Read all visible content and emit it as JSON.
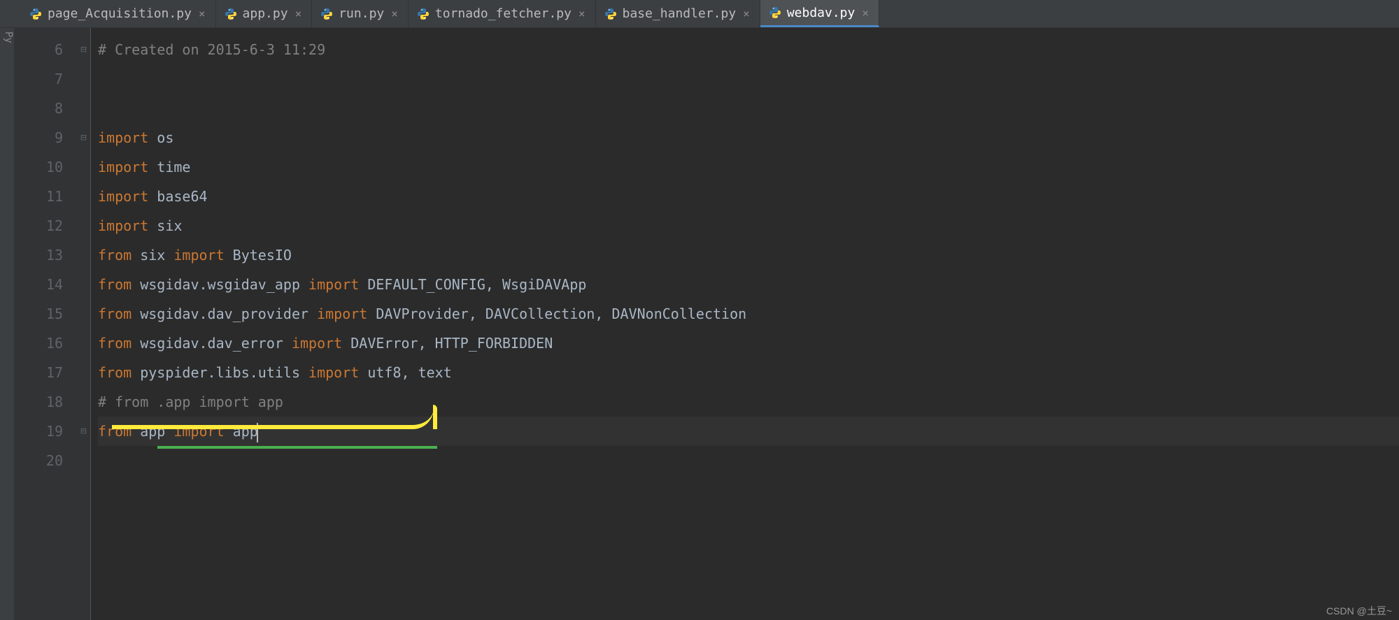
{
  "tabs": [
    {
      "label": "page_Acquisition.py",
      "active": false
    },
    {
      "label": "app.py",
      "active": false
    },
    {
      "label": "run.py",
      "active": false
    },
    {
      "label": "tornado_fetcher.py",
      "active": false
    },
    {
      "label": "base_handler.py",
      "active": false
    },
    {
      "label": "webdav.py",
      "active": true
    }
  ],
  "gutter_start": 6,
  "gutter_end": 20,
  "lines": {
    "l6": "# Created on 2015-6-3 11:29",
    "l9_kw": "import",
    "l9_txt": " os",
    "l10_kw": "import",
    "l10_txt": " time",
    "l11_kw": "import",
    "l11_txt": " base64",
    "l12_kw": "import",
    "l12_txt": " six",
    "l13_kw1": "from",
    "l13_txt1": " six ",
    "l13_kw2": "import",
    "l13_txt2": " BytesIO",
    "l14_kw1": "from",
    "l14_txt1": " wsgidav.wsgidav_app ",
    "l14_kw2": "import",
    "l14_txt2": " DEFAULT_CONFIG, WsgiDAVApp",
    "l15_kw1": "from",
    "l15_txt1": " wsgidav.dav_provider ",
    "l15_kw2": "import",
    "l15_txt2": " DAVProvider, DAVCollection, DAVNonCollection",
    "l16_kw1": "from",
    "l16_txt1": " wsgidav.dav_error ",
    "l16_kw2": "import",
    "l16_txt2": " DAVError, HTTP_FORBIDDEN",
    "l17_kw1": "from",
    "l17_txt1": " pyspider.libs.utils ",
    "l17_kw2": "import",
    "l17_txt2": " utf8, text",
    "l18": "# from .app import app",
    "l19_kw1": "from",
    "l19_txt1": " app ",
    "l19_kw2": "import",
    "l19_txt2": " app"
  },
  "watermark": "CSDN @土豆~",
  "sidebar_text": "Py"
}
